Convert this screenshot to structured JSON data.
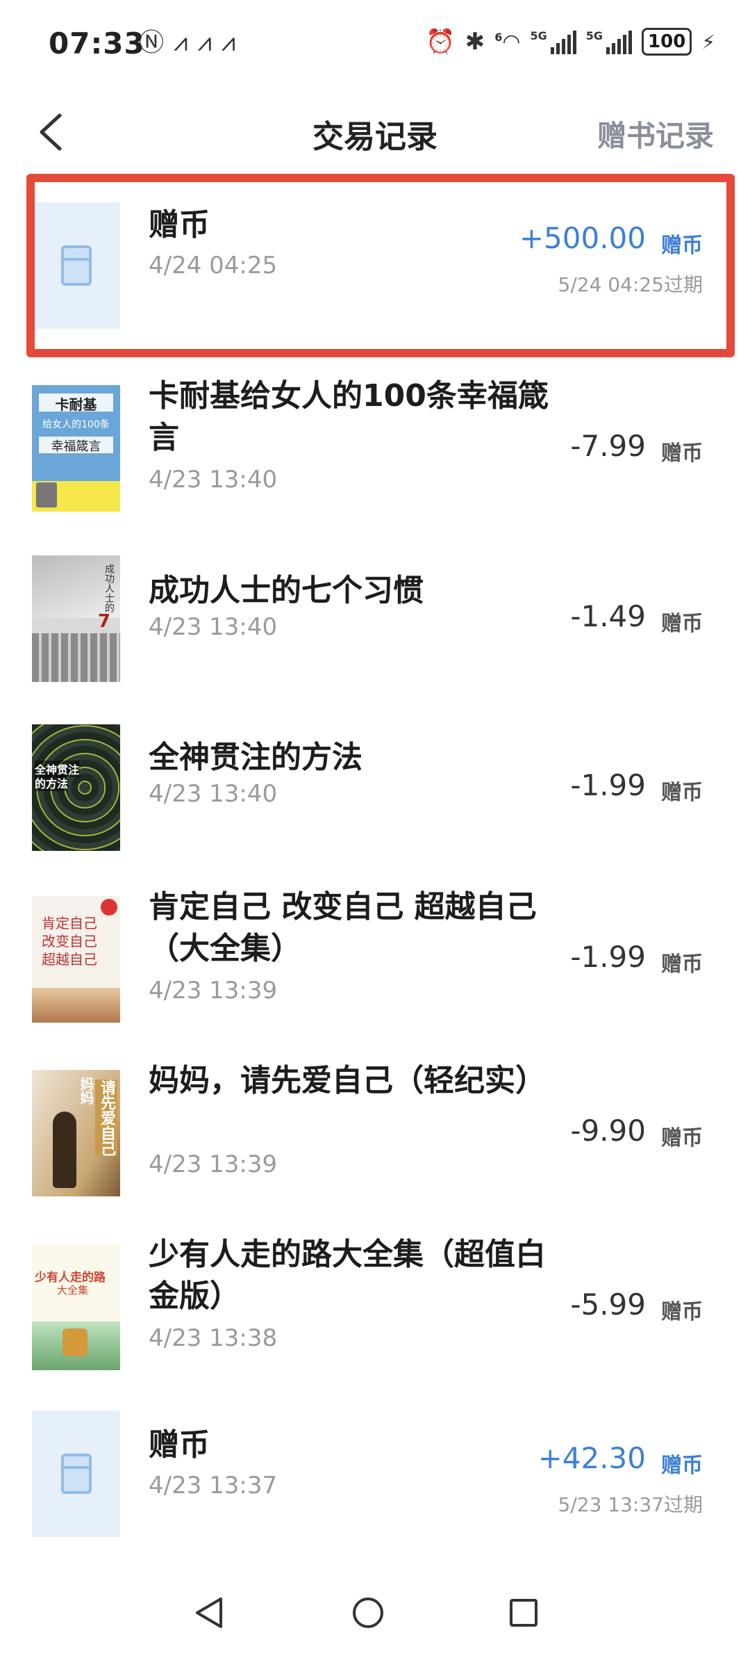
{
  "status_bar": {
    "time": "07:33",
    "left_icons": [
      "nfc-icon",
      "app-notification-icon",
      "app-notification-icon",
      "app-notification-icon"
    ],
    "right_icons": [
      "alarm-icon",
      "bluetooth-icon",
      "wifi-icon",
      "signal-icon",
      "signal-icon"
    ],
    "wifi_label": "6",
    "signal1_label": "5G",
    "signal2_label": "5G",
    "battery": "100"
  },
  "header": {
    "title": "交易记录",
    "right_link": "赠书记录"
  },
  "transactions": [
    {
      "title": "赠币",
      "date": "4/24 04:25",
      "amount": "+500.00",
      "unit": "赠币",
      "expire": "5/24 04:25过期",
      "positive": true,
      "cover": "coin"
    },
    {
      "title": "卡耐基给女人的100条幸福箴言",
      "date": "4/23 13:40",
      "amount": "-7.99",
      "unit": "赠币",
      "cover": "book1",
      "cover_text": {
        "t1": "卡耐基",
        "t2": "给女人的100条",
        "t3": "幸福箴言"
      }
    },
    {
      "title": "成功人士的七个习惯",
      "date": "4/23 13:40",
      "amount": "-1.49",
      "unit": "赠币",
      "cover": "book2",
      "cover_text": {
        "t1": "成功人士的",
        "t2": "7"
      }
    },
    {
      "title": "全神贯注的方法",
      "date": "4/23 13:40",
      "amount": "-1.99",
      "unit": "赠币",
      "cover": "book3",
      "cover_text": {
        "t1": "全神贯注",
        "t2": "的方法"
      }
    },
    {
      "title": "肯定自己 改变自己 超越自己（大全集）",
      "date": "4/23 13:39",
      "amount": "-1.99",
      "unit": "赠币",
      "cover": "book4",
      "cover_text": {
        "t1": "肯定自己",
        "t2": "改变自己",
        "t3": "超越自己"
      }
    },
    {
      "title": "妈妈，请先爱自己（轻纪实）",
      "date": "4/23 13:39",
      "amount": "-9.90",
      "unit": "赠币",
      "cover": "book5",
      "cover_text": {
        "t1": "妈妈",
        "t2": "请先爱自己"
      }
    },
    {
      "title": "少有人走的路大全集（超值白金版）",
      "date": "4/23 13:38",
      "amount": "-5.99",
      "unit": "赠币",
      "cover": "book6",
      "cover_text": {
        "t1": "少有人走的路",
        "t2": "大全集"
      }
    },
    {
      "title": "赠币",
      "date": "4/23 13:37",
      "amount": "+42.30",
      "unit": "赠币",
      "expire": "5/23 13:37过期",
      "positive": true,
      "cover": "coin"
    }
  ],
  "nav_bar": {
    "buttons": [
      "back-triangle-icon",
      "home-circle-icon",
      "recents-square-icon"
    ]
  },
  "colors": {
    "accent_blue": "#3d7fd6",
    "highlight_red": "#e5493a",
    "muted_gray": "#9a9a9a"
  }
}
